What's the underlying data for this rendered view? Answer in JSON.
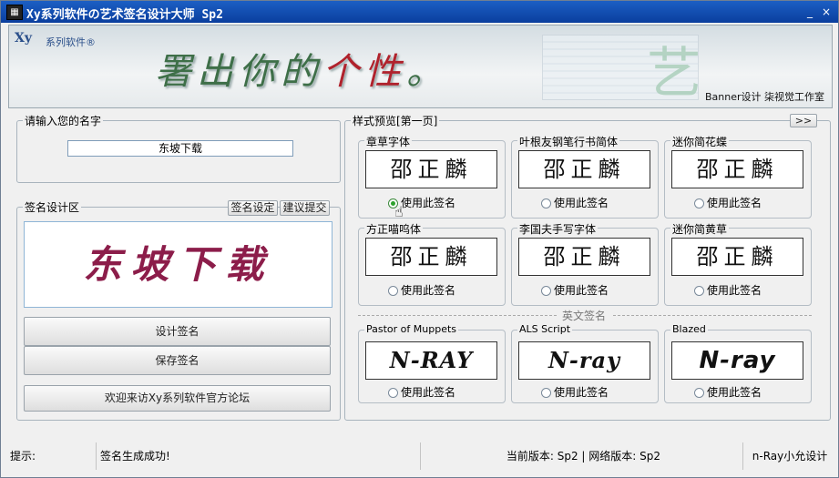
{
  "window": {
    "title": "Xy系列软件の艺术签名设计大师 Sp2",
    "min": "_",
    "close": "×"
  },
  "banner": {
    "logo": "Xy",
    "logo_text": "系列软件®",
    "slogan_a": "署出你的",
    "slogan_b": "个性",
    "slogan_c": "。",
    "credit": "Banner设计 柒视觉工作室"
  },
  "name_section": {
    "legend": "请输入您的名字",
    "value": "东坡下载"
  },
  "design_section": {
    "legend": "签名设计区",
    "btn_settings": "签名设定",
    "btn_suggest": "建议提交",
    "signature": "东坡下载",
    "btn_design": "设计签名",
    "btn_save": "保存签名",
    "btn_forum": "欢迎来访Xy系列软件官方论坛"
  },
  "preview_section": {
    "legend": "样式预览[第一页]",
    "next": ">>",
    "use_label": "使用此签名",
    "english_label": "英文签名",
    "styles": [
      {
        "name": "章草字体",
        "sample": "邵正麟",
        "selected": true
      },
      {
        "name": "叶根友钢笔行书简体",
        "sample": "邵正麟",
        "selected": false
      },
      {
        "name": "迷你简花蝶",
        "sample": "邵正麟",
        "selected": false
      },
      {
        "name": "方正喵呜体",
        "sample": "邵正麟",
        "selected": false
      },
      {
        "name": "李国夫手写字体",
        "sample": "邵正麟",
        "selected": false
      },
      {
        "name": "迷你简黄草",
        "sample": "邵正麟",
        "selected": false
      },
      {
        "name": "Pastor of Muppets",
        "sample": "N-RAY",
        "selected": false
      },
      {
        "name": "ALS Script",
        "sample": "N-ray",
        "selected": false
      },
      {
        "name": "Blazed",
        "sample": "N-ray",
        "selected": false
      }
    ]
  },
  "status": {
    "hint_label": "提示:",
    "message": "签名生成成功!",
    "version": "当前版本: Sp2 | 网络版本: Sp2",
    "author": "n-Ray小允设计"
  }
}
